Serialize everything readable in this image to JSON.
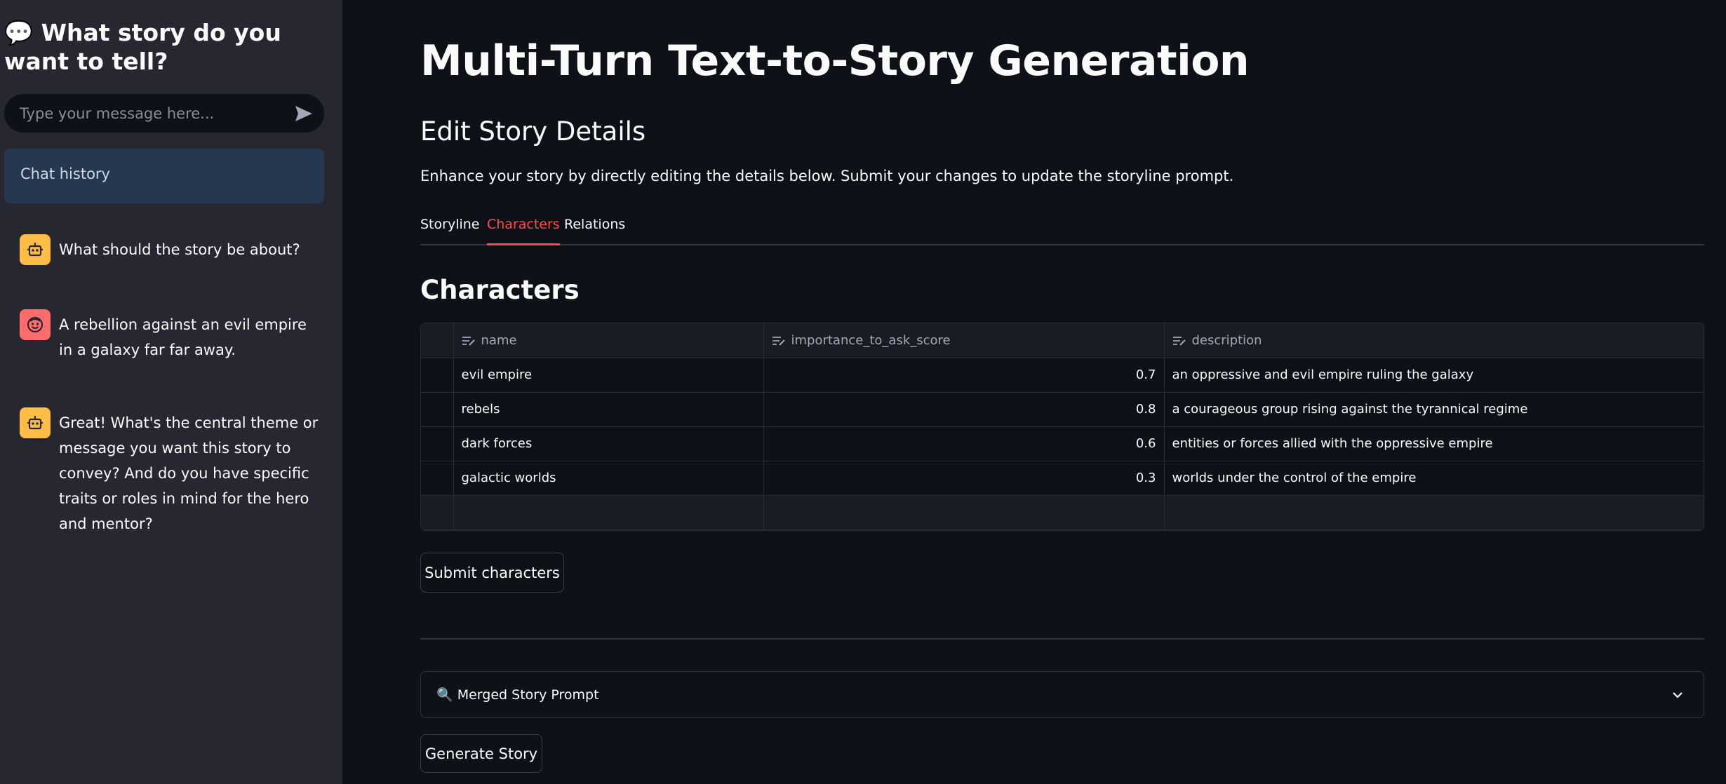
{
  "sidebar": {
    "title_icon": "💬",
    "title": "What story do you want to tell?",
    "input_placeholder": "Type your message here...",
    "history_label": "Chat history",
    "messages": [
      {
        "role": "assistant",
        "icon": "robot-icon",
        "text": "What should the story be about?"
      },
      {
        "role": "user",
        "icon": "smiley-icon",
        "text": "A rebellion against an evil empire in a galaxy far far away."
      },
      {
        "role": "assistant",
        "icon": "robot-icon",
        "text": "Great! What's the central theme or message you want this story to convey? And do you have specific traits or roles in mind for the hero and mentor?"
      }
    ]
  },
  "main": {
    "title": "Multi-Turn Text-to-Story Generation",
    "subheader": "Edit Story Details",
    "description": "Enhance your story by directly editing the details below. Submit your changes to update the storyline prompt.",
    "tabs": [
      {
        "label": "Storyline",
        "active": false
      },
      {
        "label": "Characters",
        "active": true
      },
      {
        "label": "Relations",
        "active": false
      }
    ],
    "section_title": "Characters",
    "table": {
      "columns": [
        "name",
        "importance_to_ask_score",
        "description"
      ],
      "rows": [
        {
          "name": "evil empire",
          "importance_to_ask_score": "0.7",
          "description": "an oppressive and evil empire ruling the galaxy"
        },
        {
          "name": "rebels",
          "importance_to_ask_score": "0.8",
          "description": "a courageous group rising against the tyrannical regime"
        },
        {
          "name": "dark forces",
          "importance_to_ask_score": "0.6",
          "description": "entities or forces allied with the oppressive empire"
        },
        {
          "name": "galactic worlds",
          "importance_to_ask_score": "0.3",
          "description": "worlds under the control of the empire"
        }
      ]
    },
    "submit_label": "Submit characters",
    "expander_icon": "🔍",
    "expander_label": "Merged Story Prompt",
    "generate_label": "Generate Story"
  },
  "colors": {
    "sidebar_bg": "#262730",
    "main_bg": "#0e1117",
    "accent": "#ff4b4b",
    "bot_avatar": "#ffbd45",
    "user_avatar": "#ff6c6c",
    "history_bg": "#263850"
  }
}
